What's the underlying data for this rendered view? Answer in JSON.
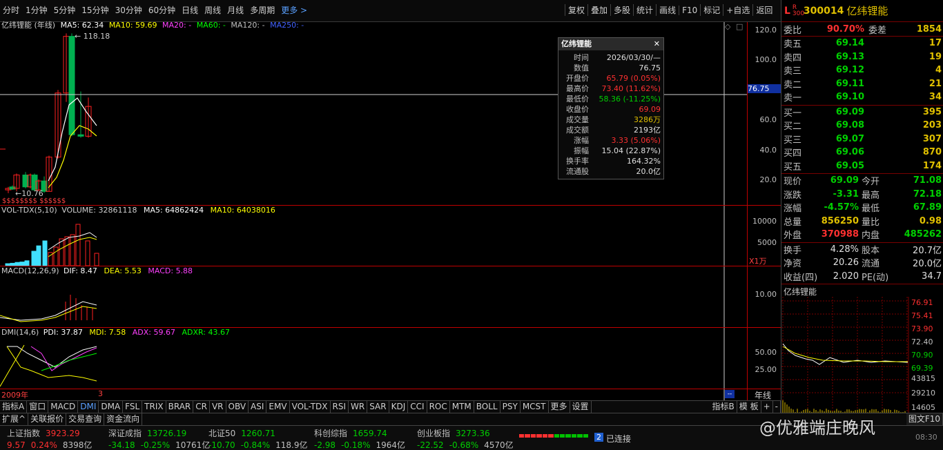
{
  "toolbar": {
    "periods": [
      "分时",
      "1分钟",
      "5分钟",
      "15分钟",
      "30分钟",
      "60分钟",
      "日线",
      "周线",
      "月线",
      "多周期",
      "更多 >"
    ],
    "tools": [
      "复权",
      "叠加",
      "多股",
      "统计",
      "画线",
      "F10",
      "标记",
      "+自选",
      "返回"
    ]
  },
  "price_pane": {
    "stock": "亿纬锂能 (年线)",
    "ma5": "MA5: 62.34",
    "ma10": "MA10: 59.69",
    "ma20": "MA20: -",
    "ma60": "MA60: -",
    "ma120": "MA120: -",
    "ma250": "MA250: -",
    "high_label": "118.18",
    "low_label": "10.76",
    "axis": [
      "120.0",
      "100.0",
      "80.0",
      "60.0",
      "40.0",
      "20.0"
    ],
    "cursor_value": "76.75",
    "dividend_marks": "$$$$$$$$           $$$$$$",
    "colors": {
      "up": "#ff2020",
      "down": "#00b050",
      "ma5": "#ffffff",
      "ma10": "#ffff00"
    }
  },
  "vol_pane": {
    "title": "VOL-TDX(5,10)",
    "volume": "VOLUME: 32861118",
    "ma5": "MA5: 64862424",
    "ma10": "MA10: 64038016",
    "axis": [
      "10000",
      "5000"
    ],
    "unit": "X1万"
  },
  "macd_pane": {
    "title": "MACD(12,26,9)",
    "dif": "DIF: 8.47",
    "dea": "DEA: 5.53",
    "macd": "MACD: 5.88",
    "axis": [
      "10.00"
    ]
  },
  "dmi_pane": {
    "title": "DMI(14,6)",
    "pdi": "PDI: 37.87",
    "mdi": "MDI: 7.58",
    "adx": "ADX: 59.67",
    "adxr": "ADXR: 43.67",
    "axis": [
      "50.00",
      "25.00"
    ],
    "x_start": "2009年",
    "x_end": "3",
    "period": "年线"
  },
  "popup": {
    "title": "亿纬锂能",
    "rows": [
      {
        "k": "时间",
        "v": "2026/03/30/—",
        "c": "white"
      },
      {
        "k": "数值",
        "v": "76.75",
        "c": "white"
      },
      {
        "k": "开盘价",
        "v": "65.79 (0.05%)",
        "c": "red"
      },
      {
        "k": "最高价",
        "v": "73.40 (11.62%)",
        "c": "red"
      },
      {
        "k": "最低价",
        "v": "58.36 (-11.25%)",
        "c": "green"
      },
      {
        "k": "收盘价",
        "v": "69.09",
        "c": "red"
      },
      {
        "k": "成交量",
        "v": "3286万",
        "c": "yellow"
      },
      {
        "k": "成交额",
        "v": "2193亿",
        "c": "white"
      },
      {
        "k": "涨幅",
        "v": "3.33 (5.06%)",
        "c": "red"
      },
      {
        "k": "振幅",
        "v": "15.04 (22.87%)",
        "c": "white"
      },
      {
        "k": "换手率",
        "v": "164.32%",
        "c": "white"
      },
      {
        "k": "流通股",
        "v": "20.0亿",
        "c": "white"
      }
    ]
  },
  "quote": {
    "badge": "L",
    "badge_sub": "R 300",
    "code": "300014",
    "name": "亿纬锂能",
    "weibi_label": "委比",
    "weibi": "90.70%",
    "weicha_label": "委差",
    "weicha": "1854",
    "asks": [
      {
        "l": "卖五",
        "p": "69.14",
        "v": "17"
      },
      {
        "l": "卖四",
        "p": "69.13",
        "v": "19"
      },
      {
        "l": "卖三",
        "p": "69.12",
        "v": "4"
      },
      {
        "l": "卖二",
        "p": "69.11",
        "v": "21"
      },
      {
        "l": "卖一",
        "p": "69.10",
        "v": "34"
      }
    ],
    "bids": [
      {
        "l": "买一",
        "p": "69.09",
        "v": "395"
      },
      {
        "l": "买二",
        "p": "69.08",
        "v": "203"
      },
      {
        "l": "买三",
        "p": "69.07",
        "v": "307"
      },
      {
        "l": "买四",
        "p": "69.06",
        "v": "870"
      },
      {
        "l": "买五",
        "p": "69.05",
        "v": "174"
      }
    ],
    "stats": [
      {
        "l1": "现价",
        "v1": "69.09",
        "c1": "green",
        "l2": "今开",
        "v2": "71.08",
        "c2": "green"
      },
      {
        "l1": "涨跌",
        "v1": "-3.31",
        "c1": "green",
        "l2": "最高",
        "v2": "72.18",
        "c2": "green"
      },
      {
        "l1": "涨幅",
        "v1": "-4.57%",
        "c1": "green",
        "l2": "最低",
        "v2": "67.89",
        "c2": "green"
      },
      {
        "l1": "总量",
        "v1": "856250",
        "c1": "yellow",
        "l2": "量比",
        "v2": "0.98",
        "c2": "yellow"
      },
      {
        "l1": "外盘",
        "v1": "370988",
        "c1": "red",
        "l2": "内盘",
        "v2": "485262",
        "c2": "green"
      }
    ],
    "stats2": [
      {
        "l1": "换手",
        "v1": "4.28%",
        "l2": "股本",
        "v2": "20.7亿"
      },
      {
        "l1": "净资",
        "v1": "20.26",
        "l2": "流通",
        "v2": "20.0亿"
      },
      {
        "l1": "收益(四)",
        "v1": "2.020",
        "l2": "PE(动)",
        "v2": "34.7"
      }
    ],
    "mini_title": "亿纬锂能",
    "mini_axis": [
      "76.91",
      "75.41",
      "73.90",
      "72.40",
      "70.90",
      "69.39"
    ],
    "mini_vol_axis": [
      "43815",
      "29210",
      "14605"
    ]
  },
  "tabs": [
    "指标A",
    "窗口",
    "MACD",
    "DMI",
    "DMA",
    "FSL",
    "TRIX",
    "BRAR",
    "CR",
    "VR",
    "OBV",
    "ASI",
    "EMV",
    "VOL-TDX",
    "RSI",
    "WR",
    "SAR",
    "KDJ",
    "CCI",
    "ROC",
    "MTM",
    "BOLL",
    "PSY",
    "MCST",
    "更多",
    "设置"
  ],
  "tabs_right": [
    "指标B",
    "模 板",
    "+",
    "-"
  ],
  "tabs2": [
    "扩展^",
    "关联报价",
    "交易查询",
    "资金流向"
  ],
  "tabs2_right": "图文F10",
  "status": {
    "indices": [
      {
        "name": "上证指数",
        "val": "3923.29",
        "chg": "9.57",
        "pct": "0.24%",
        "amt": "8398亿",
        "c": "red"
      },
      {
        "name": "深证成指",
        "val": "13726.19",
        "chg": "-34.18",
        "pct": "-0.25%",
        "amt": "10761亿",
        "c": "green"
      },
      {
        "name": "北证50",
        "val": "1260.71",
        "chg": "-10.70",
        "pct": "-0.84%",
        "amt": "118.9亿",
        "c": "green"
      },
      {
        "name": "科创综指",
        "val": "1659.74",
        "chg": "-2.98",
        "pct": "-0.18%",
        "amt": "1964亿",
        "c": "green"
      },
      {
        "name": "创业板指",
        "val": "3273.36",
        "chg": "-22.52",
        "pct": "-0.68%",
        "amt": "4570亿",
        "c": "green"
      }
    ],
    "conn_num": "2",
    "conn": "已连接",
    "time": "08:30"
  },
  "watermark": "@优雅端庄晚风"
}
